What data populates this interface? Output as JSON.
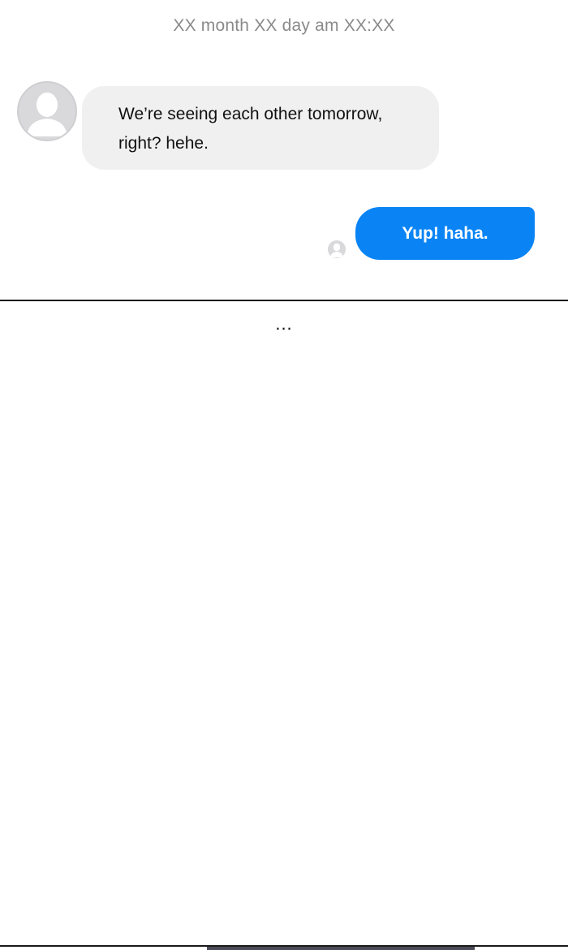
{
  "chat": {
    "timestamp": "XX month XX day am XX:XX",
    "messages": [
      {
        "sender": "other",
        "lines": [
          "We’re seeing each other tomorrow,",
          "right? hehe."
        ]
      },
      {
        "sender": "me",
        "text": "Yup! haha."
      }
    ]
  },
  "narration": {
    "text": "..."
  },
  "icons": {
    "avatar": "profile-placeholder-icon",
    "read_receipt": "read-receipt-avatar-icon"
  },
  "colors": {
    "incoming_bubble": "#f0f0f1",
    "outgoing_bubble": "#0a84f5",
    "timestamp_text": "#8a8a8a",
    "avatar_placeholder": "#d9d9db"
  }
}
